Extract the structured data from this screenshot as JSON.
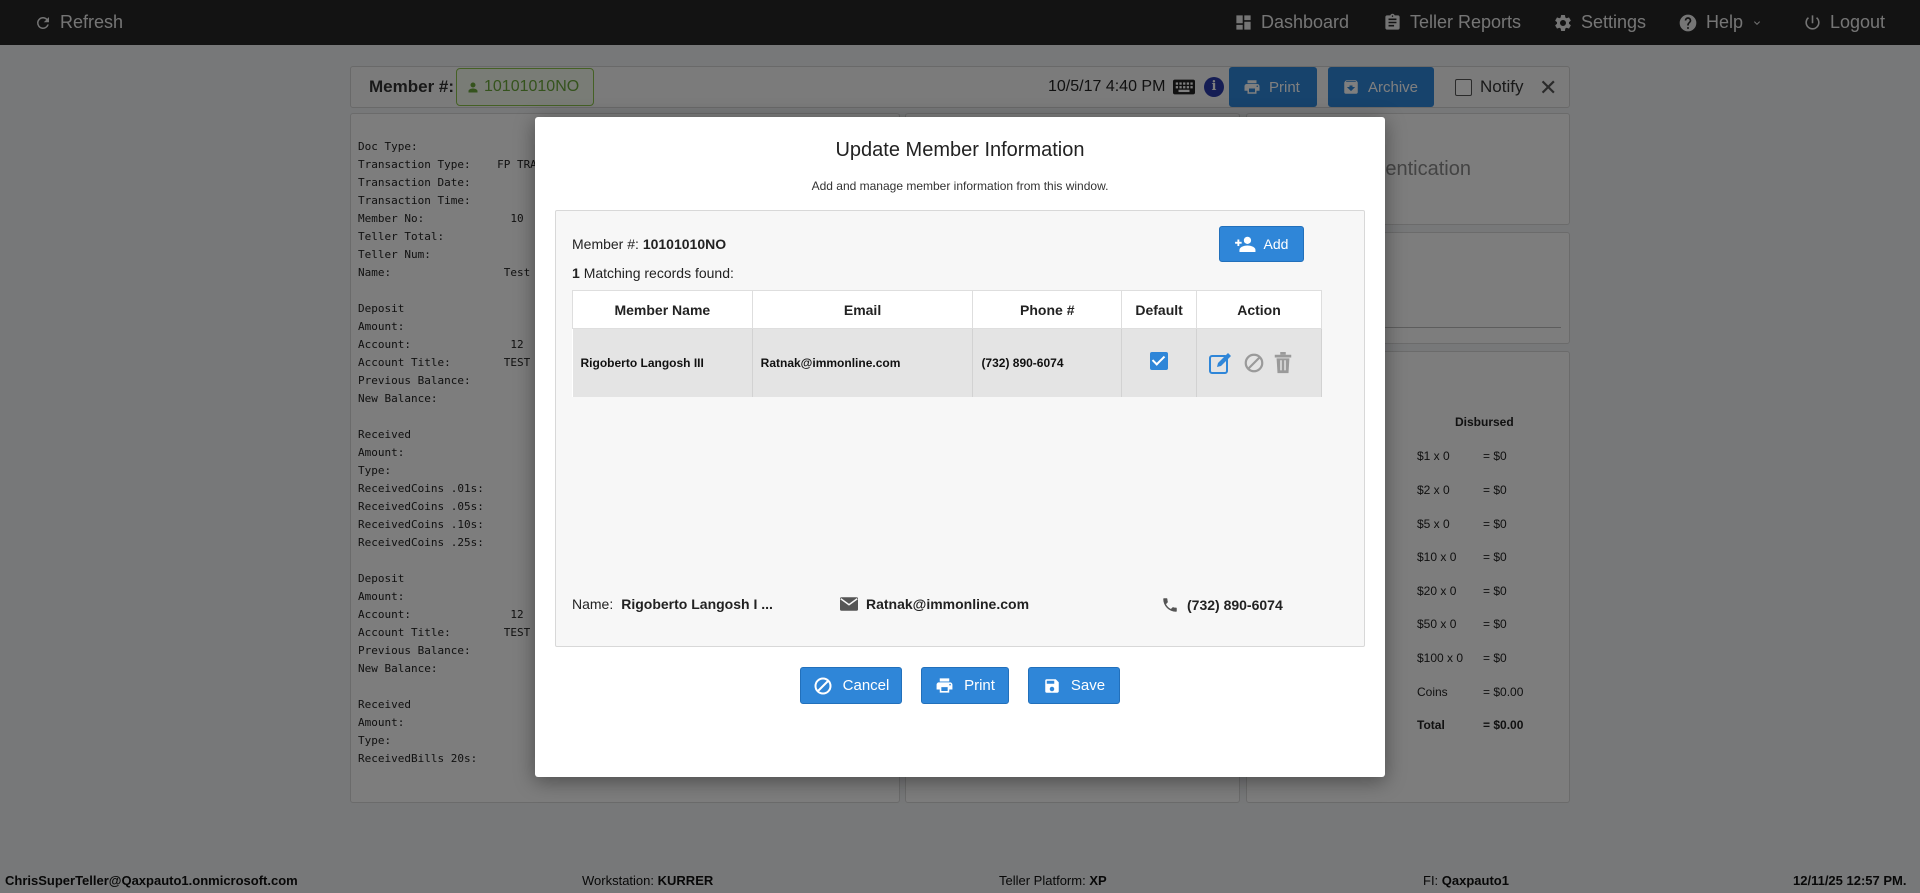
{
  "topbar": {
    "refresh_label": "Refresh",
    "dashboard_label": "Dashboard",
    "teller_reports_label": "Teller Reports",
    "settings_label": "Settings",
    "help_label": "Help",
    "logout_label": "Logout"
  },
  "strip": {
    "member_label": "Member #:",
    "member_number": "10101010NO",
    "datetime": "10/5/17 4:40 PM",
    "print_label": "Print",
    "archive_label": "Archive",
    "notify_label": "Notify"
  },
  "receipt": {
    "lines": "Doc Type:\nTransaction Type:    FP TRA\nTransaction Date:\nTransaction Time:\nMember No:             10\nTeller Total:\nTeller Num:\nName:                 Test\n\nDeposit\nAmount:\nAccount:               12\nAccount Title:        TEST\nPrevious Balance:\nNew Balance:\n\nReceived\nAmount:\nType:\nReceivedCoins .01s:\nReceivedCoins .05s:\nReceivedCoins .10s:\nReceivedCoins .25s:\n\nDeposit\nAmount:\nAccount:               12\nAccount Title:        TEST\nPrevious Balance:\nNew Balance:\n\nReceived\nAmount:\nType:\nReceivedBills 20s:"
  },
  "auth_panel": {
    "partial_text": "entication"
  },
  "disbursed": {
    "header": "Disbursed",
    "rows": [
      {
        "label": "$1 x 0",
        "value": "= $0"
      },
      {
        "label": "$2 x 0",
        "value": "= $0"
      },
      {
        "label": "$5 x 0",
        "value": "= $0"
      },
      {
        "label": "$10 x 0",
        "value": "= $0"
      },
      {
        "label": "$20 x 0",
        "value": "= $0"
      },
      {
        "label": "$50 x 0",
        "value": "= $0"
      },
      {
        "label": "$100 x 0",
        "value": "= $0"
      },
      {
        "label": "Coins",
        "value": "= $0.00"
      },
      {
        "label": "Total",
        "value": "= $0.00"
      }
    ]
  },
  "statusbar": {
    "user": "ChrisSuperTeller@Qaxpauto1.onmicrosoft.com",
    "workstation_label": "Workstation:",
    "workstation_value": "KURRER",
    "platform_label": "Teller Platform:",
    "platform_value": "XP",
    "fi_label": "FI:",
    "fi_value": "Qaxpauto1",
    "datetime": "12/11/25 12:57 PM."
  },
  "modal": {
    "title": "Update Member Information",
    "subtitle": "Add and manage member information from this window.",
    "member_label": "Member #:",
    "member_number": "10101010NO",
    "match_count": "1",
    "match_text": "Matching records found:",
    "add_label": "Add",
    "columns": [
      "Member Name",
      "Email",
      "Phone #",
      "Default",
      "Action"
    ],
    "rows": [
      {
        "name": "Rigoberto Langosh III",
        "email": "Ratnak@immonline.com",
        "phone": "(732) 890-6074",
        "default": true
      }
    ],
    "footer": {
      "name_label": "Name:",
      "name_value": "Rigoberto Langosh I ...",
      "email_value": "Ratnak@immonline.com",
      "phone_value": "(732) 890-6074"
    },
    "buttons": {
      "cancel": "Cancel",
      "print": "Print",
      "save": "Save"
    }
  },
  "colors": {
    "accent": "#2f86d8",
    "topbar": "#262626",
    "member_chip": "#8bc34a"
  }
}
